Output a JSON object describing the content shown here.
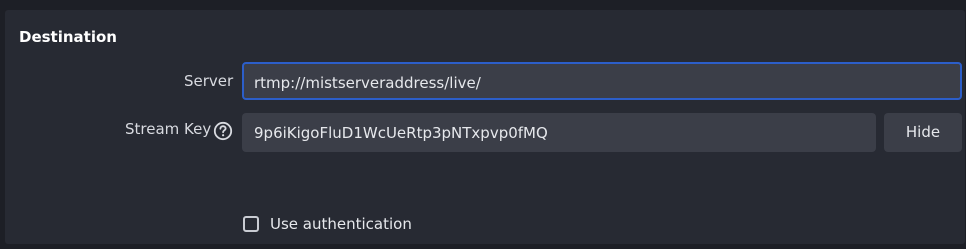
{
  "section": {
    "title": "Destination"
  },
  "server": {
    "label": "Server",
    "value": "rtmp://mistserveraddress/live/"
  },
  "stream_key": {
    "label": "Stream Key",
    "value": "9p6iKigoFluD1WcUeRtp3pNTxpvp0fMQ",
    "help_icon": "question-circle-icon",
    "hide_label": "Hide"
  },
  "authentication": {
    "label": "Use authentication",
    "checked": false
  },
  "colors": {
    "background": "#1d1f26",
    "panel": "#272a33",
    "input": "#3b3e48",
    "focus_border": "#2c5ec9",
    "text": "#e6e8ec"
  }
}
